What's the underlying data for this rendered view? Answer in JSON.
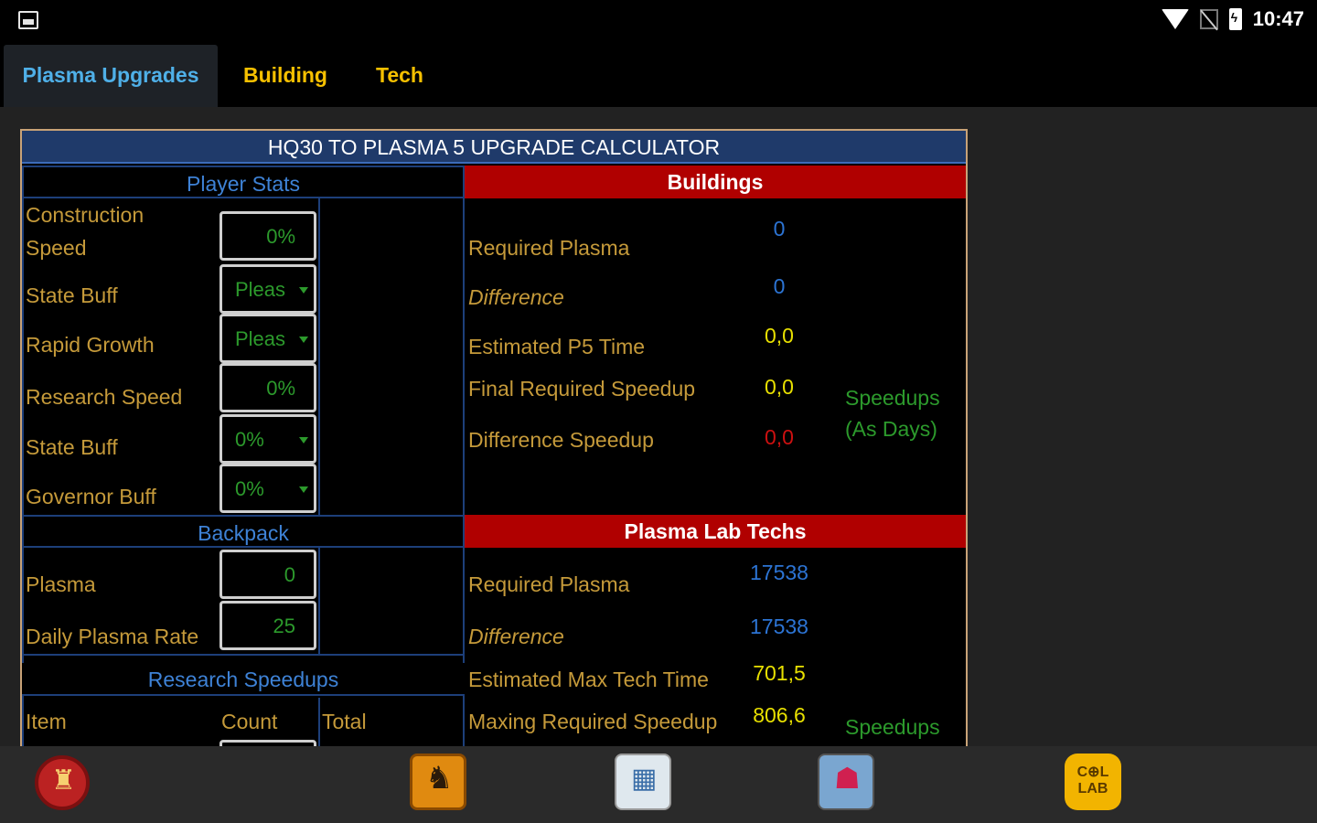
{
  "status_bar": {
    "time": "10:47",
    "icons": [
      "image-icon",
      "wifi-icon",
      "no-signal-icon",
      "battery-charging-icon"
    ]
  },
  "tabs": [
    {
      "label": "Plasma Upgrades",
      "active": true
    },
    {
      "label": "Building",
      "active": false
    },
    {
      "label": "Tech",
      "active": false
    }
  ],
  "calculator": {
    "title": "HQ30 TO PLASMA 5 UPGRADE CALCULATOR",
    "player_stats": {
      "header": "Player Stats",
      "rows": [
        {
          "label": "Construction Speed",
          "value": "0%",
          "type": "input"
        },
        {
          "label": "State Buff",
          "value": "Pleas",
          "type": "select"
        },
        {
          "label": "Rapid Growth",
          "value": "Pleas",
          "type": "select"
        },
        {
          "label": "Research Speed",
          "value": "0%",
          "type": "input"
        },
        {
          "label": "State Buff",
          "value": "0%",
          "type": "select"
        },
        {
          "label": "Governor Buff",
          "value": "0%",
          "type": "select"
        }
      ]
    },
    "backpack": {
      "header": "Backpack",
      "rows": [
        {
          "label": "Plasma",
          "value": "0"
        },
        {
          "label": "Daily Plasma Rate",
          "value": "25"
        }
      ]
    },
    "research_speedups": {
      "header": "Research Speedups",
      "columns": [
        "Item",
        "Count",
        "Total"
      ]
    },
    "buildings": {
      "header": "Buildings",
      "rows": [
        {
          "label": "Required Plasma",
          "value": "0"
        },
        {
          "label": "Difference",
          "value": "0"
        },
        {
          "label": "Estimated P5 Time",
          "value": "0,0"
        },
        {
          "label": "Final Required Speedup",
          "value": "0,0"
        },
        {
          "label": "Difference Speedup",
          "value": "0,0"
        }
      ],
      "note_line1": "Speedups",
      "note_line2": "(As Days)"
    },
    "plasma_lab_techs": {
      "header": "Plasma Lab Techs",
      "rows": [
        {
          "label": "Required Plasma",
          "value": "17538"
        },
        {
          "label": "Difference",
          "value": "17538"
        },
        {
          "label": "Estimated Max Tech Time",
          "value": "701,5"
        },
        {
          "label": "Maxing Required Speedup",
          "value": "806,6"
        }
      ],
      "note_line1": "Speedups"
    }
  },
  "bottom_apps": [
    "castle-emblem-app-icon",
    "knight-shield-app-icon",
    "calculator-app-icon",
    "character-app-icon",
    "col-lab-app-icon"
  ],
  "colors": {
    "accent_blue": "#4fb0e8",
    "tab_yellow": "#f6c000",
    "header_red": "#b00000",
    "label_gold": "#c59a3a",
    "value_green": "#2c9a2c"
  }
}
